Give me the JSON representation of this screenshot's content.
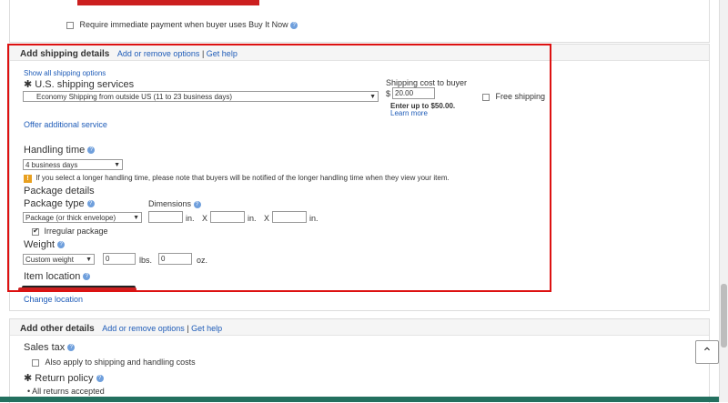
{
  "top": {
    "require_payment_label": "Require immediate payment when buyer uses Buy It Now"
  },
  "shipping": {
    "title": "Add shipping details",
    "add_remove": "Add or remove options",
    "separator": "|",
    "get_help": "Get help",
    "show_all": "Show all shipping options",
    "services_label": "U.S. shipping services",
    "service_value": "Economy Shipping from outside US (11 to 23 business days)",
    "cost_label": "Shipping cost to buyer",
    "currency": "$",
    "cost_value": "20.00",
    "cost_hint": "Enter up to $50.00.",
    "learn_more": "Learn more",
    "free_shipping": "Free shipping",
    "offer_additional": "Offer additional service",
    "handling_label": "Handling time",
    "handling_value": "4 business days",
    "handling_note": "If you select a longer handling time, please note that buyers will be notified of the longer handling time when they view your item.",
    "package_details": "Package details",
    "package_type_label": "Package type",
    "package_type_value": "Package (or thick envelope)",
    "dimensions_label": "Dimensions",
    "in1": "in.",
    "x1": "X",
    "in2": "in.",
    "x2": "X",
    "in3": "in.",
    "irregular": "Irregular package",
    "weight_label": "Weight",
    "weight_value": "Custom weight",
    "lbs_value": "0",
    "lbs": "lbs.",
    "oz_value": "0",
    "oz": "oz.",
    "item_location": "Item location",
    "change_location": "Change location"
  },
  "other": {
    "title": "Add other details",
    "add_remove": "Add or remove options",
    "separator": "|",
    "get_help": "Get help",
    "sales_tax": "Sales tax",
    "also_apply": "Also apply to shipping and handling costs",
    "return_policy": "Return policy",
    "returns_accepted": "All returns accepted"
  },
  "colors": {
    "highlight_box": "#d11111",
    "link": "#1f5cb8"
  }
}
